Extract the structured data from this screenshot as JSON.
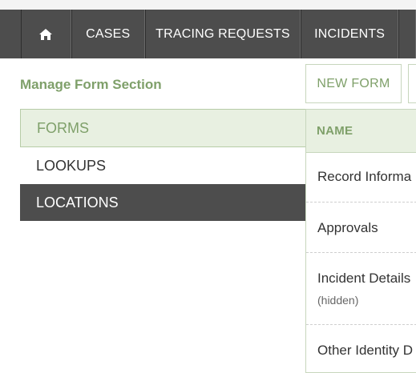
{
  "nav": {
    "home_icon": "home-icon",
    "items": [
      "CASES",
      "TRACING REQUESTS",
      "INCIDENTS"
    ]
  },
  "page": {
    "title": "Manage Form Section",
    "new_form_label": "NEW FORM"
  },
  "sidebar": {
    "items": [
      {
        "label": "FORMS",
        "state": "selected"
      },
      {
        "label": "LOOKUPS",
        "state": "default"
      },
      {
        "label": "LOCATIONS",
        "state": "hover"
      }
    ]
  },
  "table": {
    "header": "NAME",
    "rows": [
      {
        "name": "Record Informa"
      },
      {
        "name": "Approvals"
      },
      {
        "name": "Incident Details",
        "note": "(hidden)"
      },
      {
        "name": "Other Identity D"
      }
    ]
  },
  "colors": {
    "nav_bg": "#4d4d4d",
    "accent_green": "#7fa06a",
    "selected_bg": "#e8f0e1"
  }
}
